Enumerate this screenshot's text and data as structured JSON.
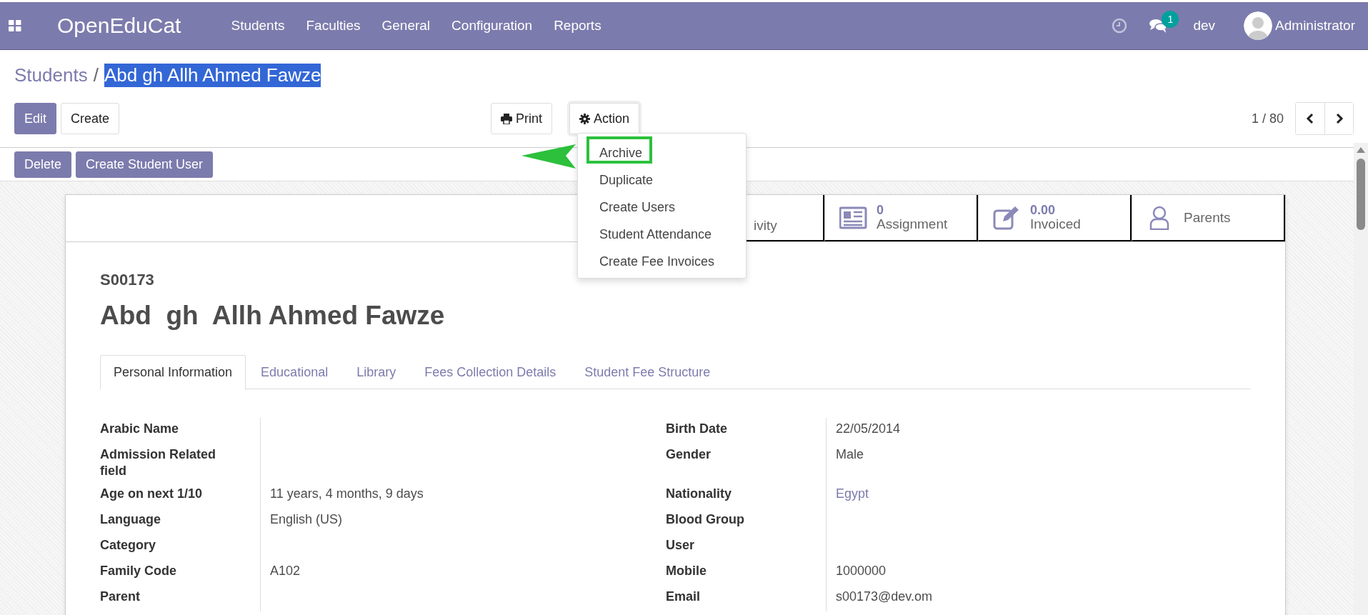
{
  "navbar": {
    "brand": "OpenEduCat",
    "menu": [
      "Students",
      "Faculties",
      "General",
      "Configuration",
      "Reports"
    ],
    "messages_badge": "1",
    "company": "dev",
    "user": "Administrator"
  },
  "breadcrumb": {
    "parent": "Students",
    "separator": "/",
    "current": "Abd gh Allh Ahmed Fawze",
    "current_selected": true
  },
  "toolbar": {
    "edit": "Edit",
    "create": "Create",
    "print": "Print",
    "action": "Action",
    "pager": "1 / 80"
  },
  "action_menu": {
    "items": [
      {
        "label": "Archive",
        "highlighted": true
      },
      {
        "label": "Duplicate",
        "highlighted": false
      },
      {
        "label": "Create Users",
        "highlighted": false
      },
      {
        "label": "Student Attendance",
        "highlighted": false
      },
      {
        "label": "Create Fee Invoices",
        "highlighted": false
      }
    ]
  },
  "statusbar_buttons": [
    "Delete",
    "Create Student User"
  ],
  "stat_buttons": [
    {
      "kind": "partial",
      "label": "ivity"
    },
    {
      "kind": "assignment",
      "value": "0",
      "label": "Assignment"
    },
    {
      "kind": "invoice",
      "value": "0.00",
      "label": "Invoiced"
    },
    {
      "kind": "person",
      "label": "Parents"
    }
  ],
  "record": {
    "code": "S00173",
    "name": "Abd  gh  Allh Ahmed Fawze"
  },
  "tabs": [
    {
      "label": "Personal Information",
      "selected": true
    },
    {
      "label": "Educational",
      "selected": false
    },
    {
      "label": "Library",
      "selected": false
    },
    {
      "label": "Fees Collection Details",
      "selected": false
    },
    {
      "label": "Student Fee Structure",
      "selected": false
    }
  ],
  "fields": [
    {
      "left": {
        "label": "Arabic Name"
      },
      "right": {
        "label": "Birth Date",
        "value": "22/05/2014",
        "kind": "text"
      }
    },
    {
      "left": {
        "label": "Admission Related field"
      },
      "right": {
        "label": "Gender",
        "value": "Male",
        "kind": "text"
      }
    },
    {
      "left": {
        "label": "Age on next 1/10",
        "value": "11 years, 4 months, 9 days"
      },
      "right": {
        "label": "Nationality",
        "value": "Egypt",
        "kind": "link"
      }
    },
    {
      "left": {
        "label": "Language",
        "value": "English (US)"
      },
      "right": {
        "label": "Blood Group"
      }
    },
    {
      "left": {
        "label": "Category"
      },
      "right": {
        "label": "User"
      }
    },
    {
      "left": {
        "label": "Family Code",
        "value": "A102"
      },
      "right": {
        "label": "Mobile",
        "value": "1000000",
        "kind": "text"
      }
    },
    {
      "left": {
        "label": "Parent"
      },
      "right": {
        "label": "Email",
        "value": "s00173@dev.om",
        "kind": "text"
      }
    }
  ]
}
